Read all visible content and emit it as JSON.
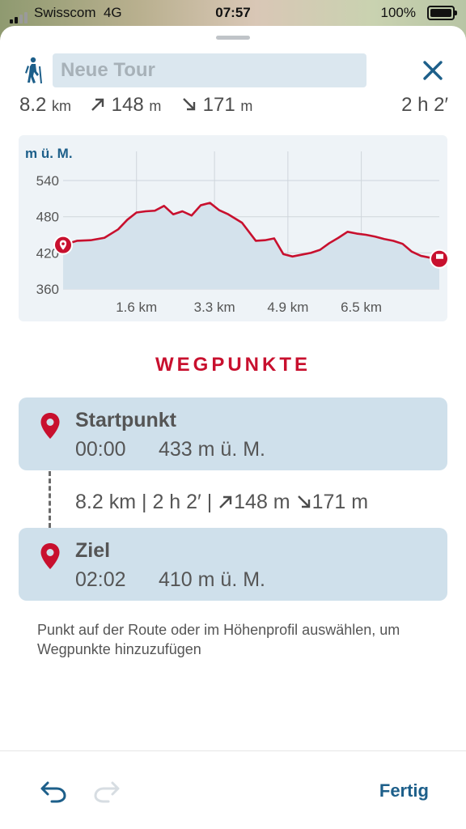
{
  "status_bar": {
    "carrier": "Swisscom",
    "network": "4G",
    "time": "07:57",
    "battery": "100%"
  },
  "header": {
    "title_placeholder": "Neue Tour",
    "activity_icon": "hiker-icon",
    "close_icon": "close-icon"
  },
  "stats": {
    "distance_value": "8.2",
    "distance_unit": "km",
    "ascent_value": "148",
    "ascent_unit": "m",
    "descent_value": "171",
    "descent_unit": "m",
    "duration": "2 h 2′"
  },
  "chart_data": {
    "type": "area",
    "ylabel": "m ü. M.",
    "yticks": [
      360,
      420,
      480,
      540
    ],
    "xticks": [
      "1.6 km",
      "3.3 km",
      "4.9 km",
      "6.5 km"
    ],
    "xlim": [
      0,
      8.2
    ],
    "ylim": [
      360,
      575
    ],
    "x": [
      0,
      0.3,
      0.6,
      0.9,
      1.2,
      1.4,
      1.6,
      1.8,
      2.0,
      2.2,
      2.4,
      2.6,
      2.8,
      3.0,
      3.2,
      3.4,
      3.6,
      3.9,
      4.2,
      4.4,
      4.6,
      4.8,
      5.0,
      5.2,
      5.4,
      5.6,
      5.8,
      6.0,
      6.2,
      6.4,
      6.6,
      6.8,
      7.0,
      7.2,
      7.4,
      7.6,
      7.8,
      8.0,
      8.2
    ],
    "y": [
      433,
      440,
      441,
      445,
      459,
      475,
      487,
      489,
      490,
      498,
      484,
      489,
      482,
      499,
      503,
      491,
      484,
      470,
      440,
      441,
      444,
      418,
      414,
      417,
      420,
      425,
      436,
      445,
      455,
      452,
      450,
      447,
      443,
      440,
      435,
      422,
      415,
      412,
      410
    ],
    "fill_color": "#d4e2ec",
    "line_color": "#c8102e"
  },
  "waypoints_section": {
    "title": "WEGPUNKTE",
    "items": [
      {
        "name": "Startpunkt",
        "time": "00:00",
        "elevation": "433 m ü. M."
      },
      {
        "name": "Ziel",
        "time": "02:02",
        "elevation": "410 m ü. M."
      }
    ],
    "segment": {
      "distance": "8.2 km",
      "duration": "2 h 2′",
      "ascent": "148 m",
      "descent": "171 m"
    },
    "hint": "Punkt auf der Route oder im Höhenprofil auswählen, um Wegpunkte hinzuzufügen"
  },
  "toolbar": {
    "done_label": "Fertig"
  },
  "colors": {
    "accent_red": "#c8102e",
    "accent_blue": "#1d5f8a",
    "card_bg": "#cfe0eb"
  }
}
